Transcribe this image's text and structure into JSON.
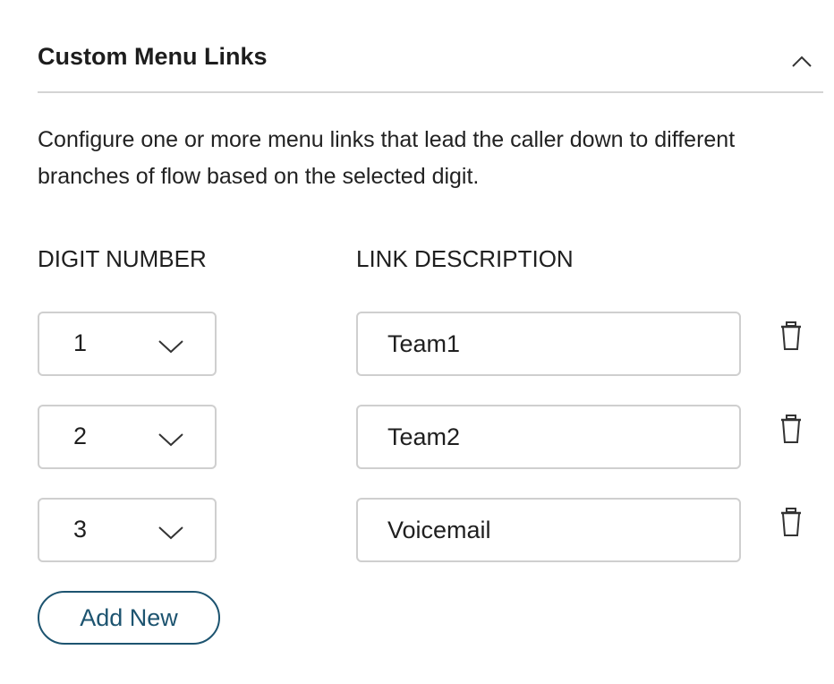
{
  "section": {
    "title": "Custom Menu Links",
    "collapse_icon": "chevron-up-icon",
    "description": "Configure one or more menu links that lead the caller down to different branches of flow based on the selected digit."
  },
  "columns": {
    "digit": "DIGIT NUMBER",
    "description": "LINK DESCRIPTION"
  },
  "links": [
    {
      "digit": "1",
      "description": "Team1",
      "delete_icon": "trash-icon"
    },
    {
      "digit": "2",
      "description": "Team2",
      "delete_icon": "trash-icon"
    },
    {
      "digit": "3",
      "description": "Voicemail",
      "delete_icon": "trash-icon"
    }
  ],
  "add_button": {
    "label": "Add New"
  },
  "colors": {
    "accent": "#1d5470",
    "border": "#cfcfcf",
    "divider": "#d4d4d4",
    "text": "#1f1f1f"
  }
}
